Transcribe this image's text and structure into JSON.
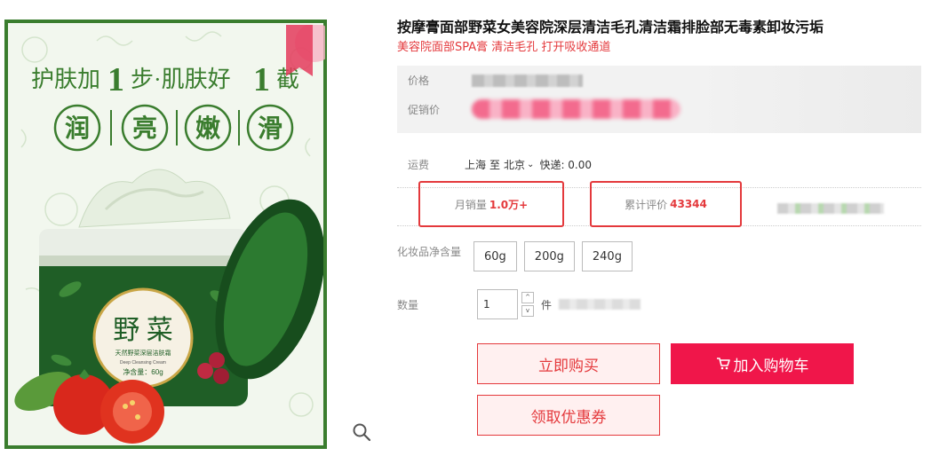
{
  "product": {
    "title": "按摩膏面部野菜女美容院深层清洁毛孔清洁霜排脸部无毒素卸妆污垢",
    "subtitle": "美容院面部SPA膏 清洁毛孔 打开吸收通道"
  },
  "image": {
    "slogan_prefix": "护肤加",
    "slogan_num1": "1",
    "slogan_mid": "步·肌肤好",
    "slogan_num2": "1",
    "slogan_suffix": "截",
    "features": [
      "润",
      "亮",
      "嫩",
      "滑"
    ],
    "jar_brand": "野 菜",
    "jar_line1": "天然野菜深层洁肤霜",
    "jar_line2": "Deep Cleansing Cream",
    "jar_weight": "净含量：60g"
  },
  "price": {
    "label": "价格",
    "promo_label": "促销价"
  },
  "shipping": {
    "label": "运费",
    "from": "上海",
    "to_word": "至",
    "to": "北京",
    "chevron": "✔",
    "fee": "快递: 0.00"
  },
  "stats": {
    "sales_label": "月销量",
    "sales_value": "1.0万+",
    "reviews_label": "累计评价",
    "reviews_value": "43344"
  },
  "spec": {
    "label": "化妆品净含量",
    "options": [
      "60g",
      "200g",
      "240g"
    ]
  },
  "quantity": {
    "label": "数量",
    "value": "1",
    "unit": "件",
    "up": "^",
    "down": "v"
  },
  "actions": {
    "buy": "立即购买",
    "cart": "加入购物车",
    "coupon": "领取优惠券"
  },
  "colors": {
    "accent": "#e4393c",
    "cart": "#f0164a",
    "frame": "#3a7d2e"
  },
  "icons": {
    "zoom": "magnifier-icon",
    "cart": "cart-icon",
    "chevron": "chevron-down-icon"
  }
}
